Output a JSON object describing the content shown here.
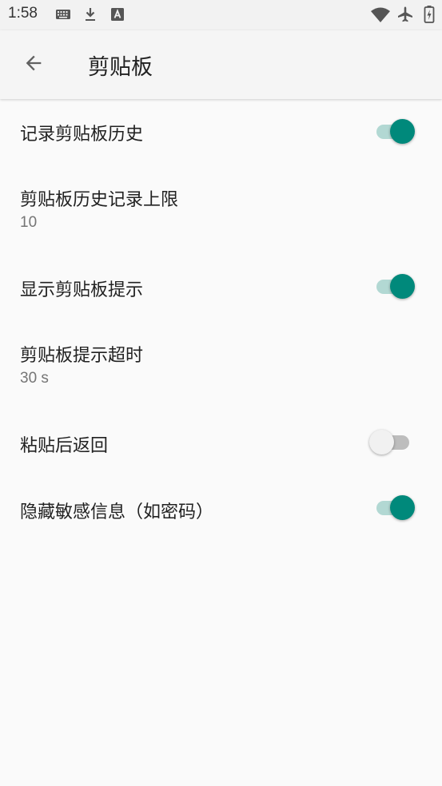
{
  "status_bar": {
    "time": "1:58",
    "icons": [
      "keyboard-icon",
      "download-icon",
      "a-badge-icon",
      "wifi-icon",
      "airplane-icon",
      "battery-charging-icon"
    ]
  },
  "app_bar": {
    "back_icon": "arrow-back-icon",
    "title": "剪贴板"
  },
  "settings": [
    {
      "title": "记录剪贴板历史",
      "type": "switch",
      "checked": true
    },
    {
      "title": "剪贴板历史记录上限",
      "summary": "10",
      "type": "value"
    },
    {
      "title": "显示剪贴板提示",
      "type": "switch",
      "checked": true
    },
    {
      "title": "剪贴板提示超时",
      "summary": "30 s",
      "type": "value"
    },
    {
      "title": "粘贴后返回",
      "type": "switch",
      "checked": false
    },
    {
      "title": "隐藏敏感信息（如密码）",
      "type": "switch",
      "checked": true
    }
  ],
  "colors": {
    "accent": "#00897b",
    "accent_track": "#b2d8d3",
    "background": "#fafafa"
  }
}
